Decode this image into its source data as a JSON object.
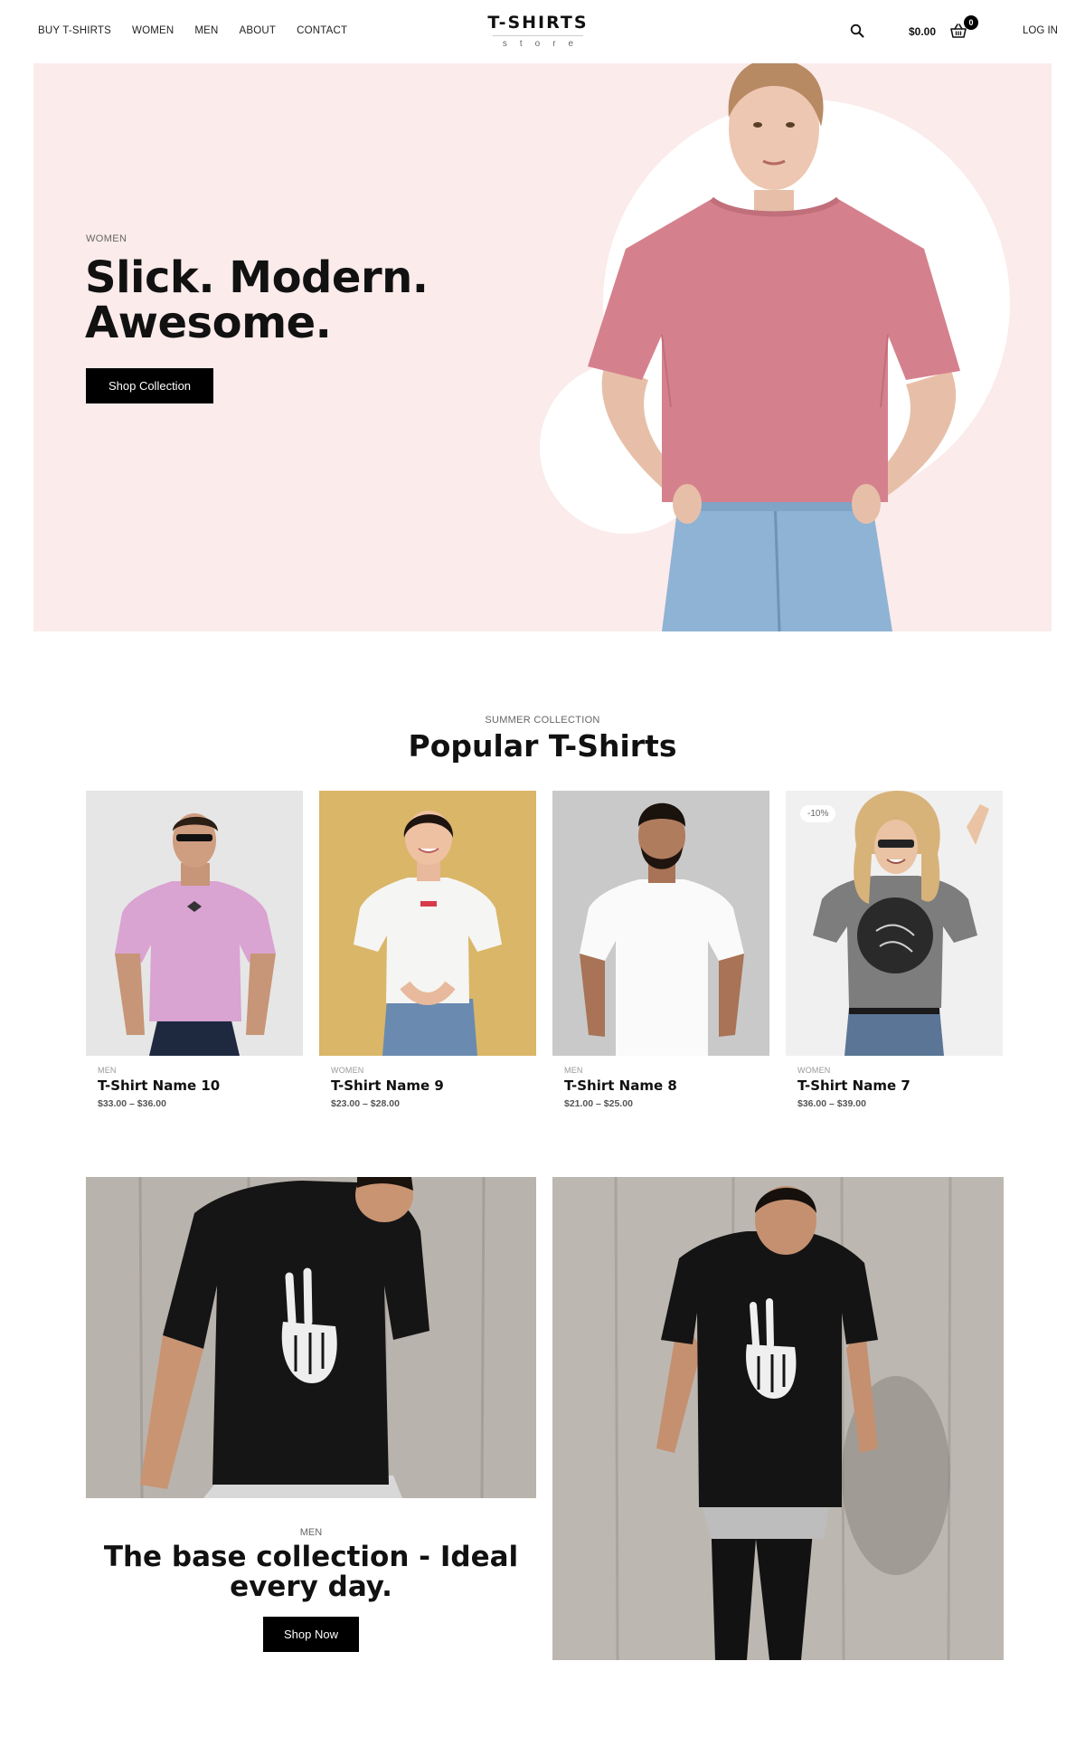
{
  "header": {
    "nav": [
      "BUY T-SHIRTS",
      "WOMEN",
      "MEN",
      "ABOUT",
      "CONTACT"
    ],
    "logo_title": "T-SHIRTS",
    "logo_sub": "store",
    "cart_total": "$0.00",
    "cart_count": "0",
    "login": "LOG IN"
  },
  "hero": {
    "eyebrow": "WOMEN",
    "title": "Slick. Modern. Awesome.",
    "button": "Shop Collection"
  },
  "popular": {
    "eyebrow": "SUMMER COLLECTION",
    "title": "Popular T-Shirts",
    "products": [
      {
        "category": "MEN",
        "name": "T-Shirt Name 10",
        "price": "$33.00 – $36.00"
      },
      {
        "category": "WOMEN",
        "name": "T-Shirt Name 9",
        "price": "$23.00 – $28.00"
      },
      {
        "category": "MEN",
        "name": "T-Shirt Name 8",
        "price": "$21.00 – $25.00"
      },
      {
        "category": "WOMEN",
        "name": "T-Shirt Name 7",
        "price": "$36.00 – $39.00",
        "badge": "-10%"
      }
    ]
  },
  "promo": {
    "eyebrow": "MEN",
    "title": "The base collection - Ideal every day.",
    "button": "Shop Now"
  },
  "colors": {
    "hero_bg": "#fbebeb",
    "accent": "#000000"
  }
}
